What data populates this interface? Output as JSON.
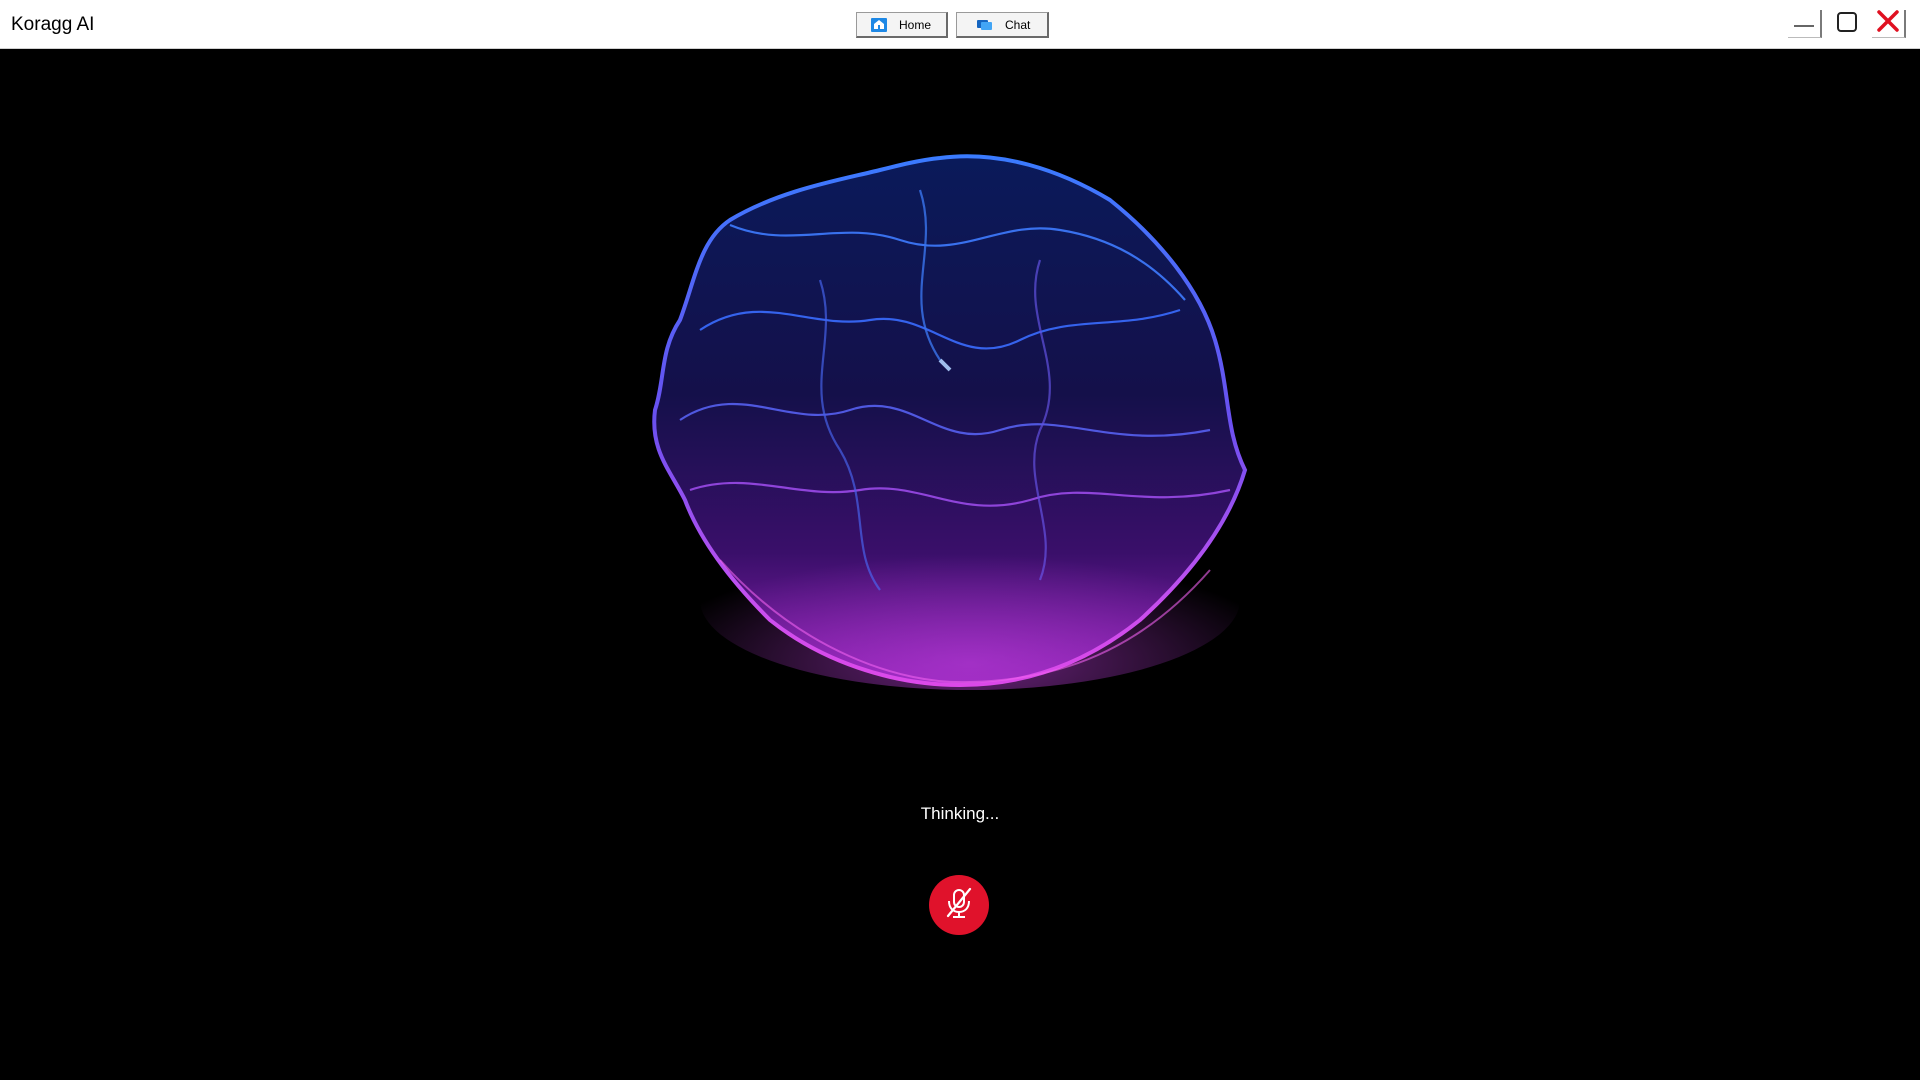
{
  "window": {
    "title": "Koragg AI"
  },
  "nav": {
    "home_label": "Home",
    "chat_label": "Chat"
  },
  "controls": {
    "minimize_icon": "minimize-icon",
    "maximize_icon": "maximize-icon",
    "close_icon": "close-icon"
  },
  "status": {
    "text": "Thinking..."
  },
  "mic": {
    "icon": "mic-off-icon",
    "color": "#e0122b",
    "state": "muted"
  },
  "colors": {
    "background": "#000000",
    "orb_top": "#2a5cff",
    "orb_bottom": "#e040f0",
    "close_accent": "#e01020"
  }
}
